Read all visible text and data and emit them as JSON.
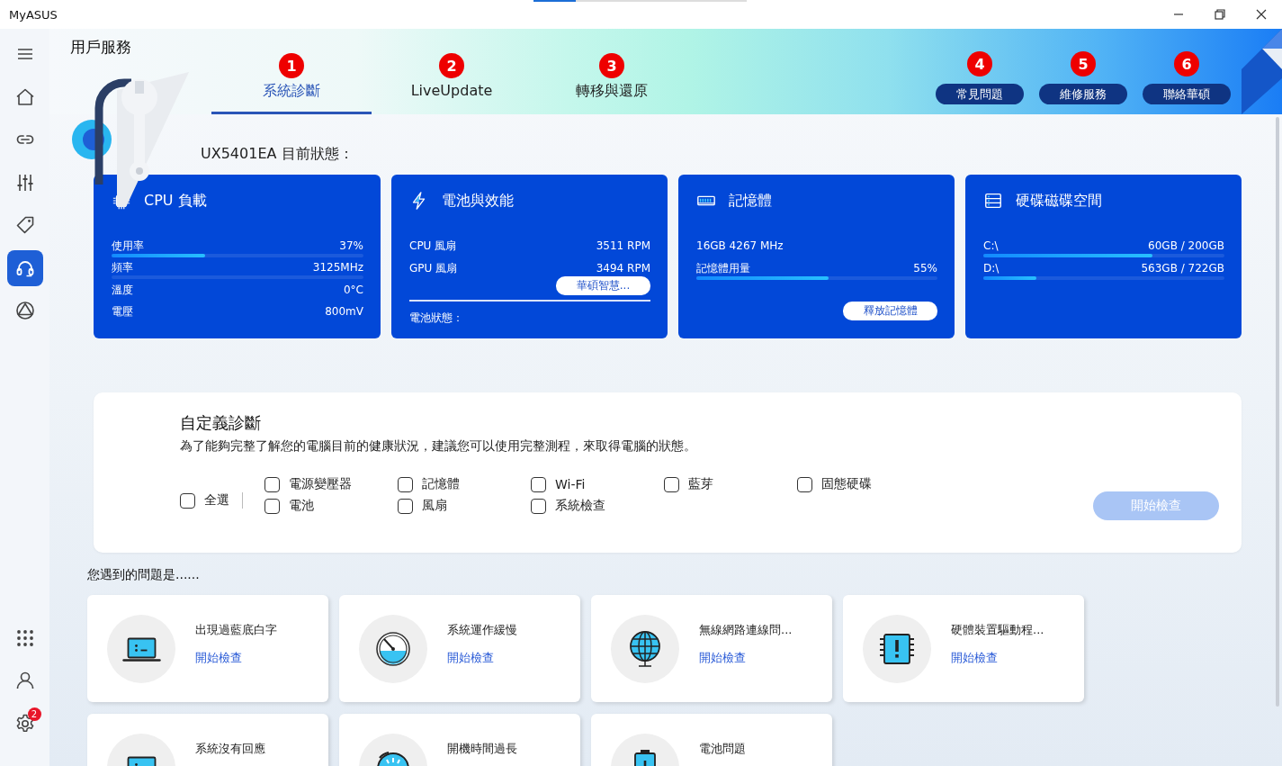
{
  "window": {
    "title": "MyASUS"
  },
  "sidebar": {
    "items": [
      {
        "kind": "menu",
        "selected": false
      },
      {
        "kind": "home",
        "selected": false
      },
      {
        "kind": "link",
        "selected": false
      },
      {
        "kind": "sliders",
        "selected": false
      },
      {
        "kind": "tag",
        "selected": false
      },
      {
        "kind": "headset",
        "selected": true
      },
      {
        "kind": "triangle",
        "selected": false
      }
    ],
    "bottom_items": [
      {
        "kind": "apps",
        "selected": false
      },
      {
        "kind": "user",
        "selected": false
      },
      {
        "kind": "gear",
        "selected": false,
        "badge": "2"
      }
    ]
  },
  "header": {
    "title": "用戶服務",
    "tabs": [
      {
        "marker": "1",
        "label": "系統診斷",
        "selected": true
      },
      {
        "marker": "2",
        "label": "LiveUpdate",
        "selected": false
      },
      {
        "marker": "3",
        "label": "轉移與還原",
        "selected": false
      }
    ],
    "buttons": [
      {
        "marker": "4",
        "label": "常見問題"
      },
      {
        "marker": "5",
        "label": "維修服務"
      },
      {
        "marker": "6",
        "label": "聯絡華碩"
      }
    ]
  },
  "status": {
    "heading": "UX5401EA 目前狀態：",
    "cards": [
      {
        "kind": "chip",
        "title": "CPU 負載",
        "items": [
          {
            "kind": "stat",
            "label": "使用率",
            "value": "37%",
            "level": 0.37
          },
          {
            "kind": "stat_track",
            "label": "頻率",
            "value": "3125MHz"
          },
          {
            "kind": "stat",
            "label": "溫度",
            "value": "0°C"
          },
          {
            "kind": "stat",
            "label": "電壓",
            "value": "800mV"
          }
        ]
      },
      {
        "kind": "bolt",
        "title": "電池與效能",
        "items": [
          {
            "kind": "stat",
            "label": "CPU 風扇",
            "value": "3511 RPM"
          },
          {
            "kind": "stat",
            "label": "GPU 風扇",
            "value": "3494 RPM"
          },
          {
            "kind": "button",
            "label": "華碩智慧..."
          },
          {
            "kind": "note",
            "label": "電池狀態："
          }
        ]
      },
      {
        "kind": "ram",
        "title": "記憶體",
        "items": [
          {
            "kind": "info",
            "label": "16GB 4267 MHz"
          },
          {
            "kind": "stat",
            "label": "記憶體用量",
            "value": "55%",
            "level": 0.55
          },
          {
            "kind": "button",
            "label": "釋放記憶體"
          }
        ]
      },
      {
        "kind": "disk",
        "title": "硬碟磁碟空間",
        "items": [
          {
            "kind": "stat",
            "label": "C:\\",
            "value": "60GB / 200GB",
            "level": 0.7
          },
          {
            "kind": "stat",
            "label": "D:\\",
            "value": "563GB / 722GB",
            "level": 0.22
          }
        ]
      }
    ]
  },
  "custom": {
    "title": "自定義診斷",
    "description": "為了能夠完整了解您的電腦目前的健康狀況，建議您可以使用完整測程，來取得電腦的狀態。",
    "select_all": {
      "label": "全選",
      "checked": false
    },
    "option_columns": [
      [
        {
          "label": "電源變壓器",
          "checked": false
        },
        {
          "label": "電池",
          "checked": false
        }
      ],
      [
        {
          "label": "記憶體",
          "checked": false
        },
        {
          "label": "風扇",
          "checked": false
        }
      ],
      [
        {
          "label": "Wi-Fi",
          "checked": false
        },
        {
          "label": "系統檢查",
          "checked": false
        }
      ],
      [
        {
          "label": "藍芽",
          "checked": false
        }
      ],
      [
        {
          "label": "固態硬碟",
          "checked": false
        }
      ]
    ],
    "start_button": {
      "label": "開始檢查",
      "disabled": true
    }
  },
  "problems": {
    "heading": "您遇到的問題是......",
    "items": [
      {
        "kind": "laptop",
        "title": "出現過藍底白字",
        "link": "開始檢查"
      },
      {
        "kind": "gauge",
        "title": "系統運作緩慢",
        "link": "開始檢查"
      },
      {
        "kind": "globe",
        "title": "無線網路連線問...",
        "link": "開始檢查"
      },
      {
        "kind": "chip",
        "title": "硬體裝置驅動程...",
        "link": "開始檢查"
      },
      {
        "kind": "laptop",
        "title": "系統沒有回應"
      },
      {
        "kind": "stopwatch",
        "title": "開機時間過長"
      },
      {
        "kind": "battery",
        "title": "電池問題"
      }
    ]
  }
}
